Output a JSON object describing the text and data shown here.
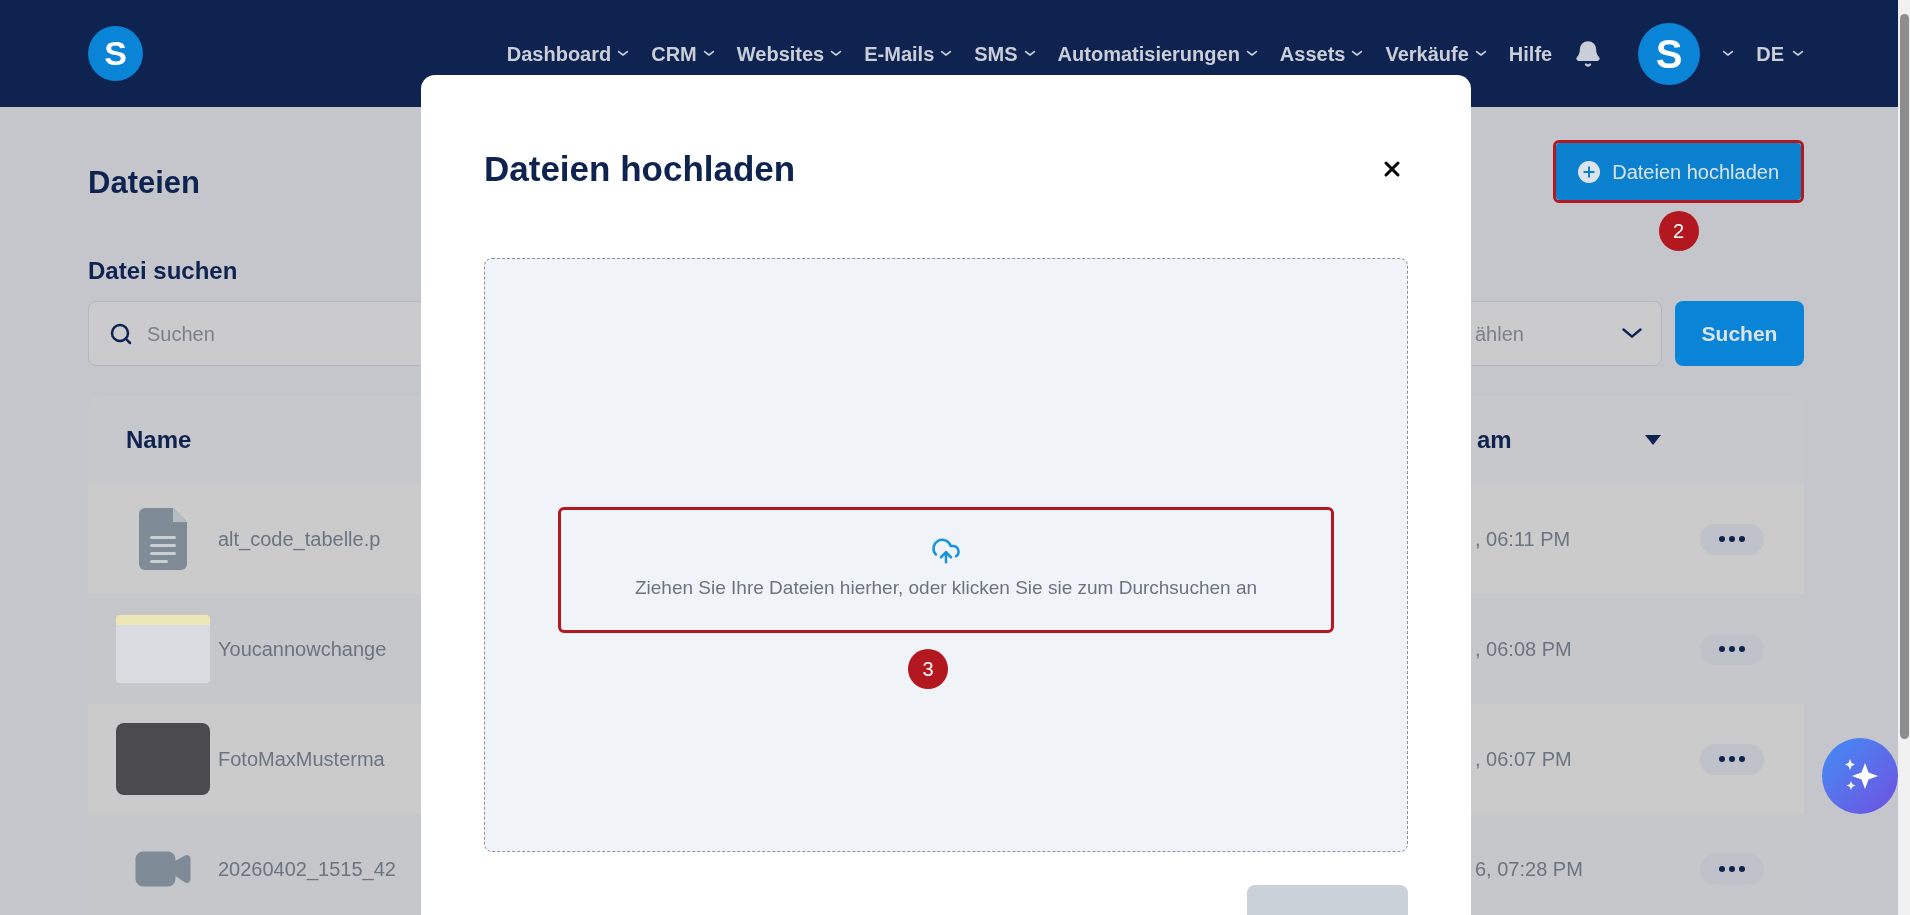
{
  "nav": {
    "logo": "S",
    "items": [
      {
        "label": "Dashboard",
        "dropdown": true
      },
      {
        "label": "CRM",
        "dropdown": true
      },
      {
        "label": "Websites",
        "dropdown": true
      },
      {
        "label": "E-Mails",
        "dropdown": true
      },
      {
        "label": "SMS",
        "dropdown": true
      },
      {
        "label": "Automatisierungen",
        "dropdown": true
      },
      {
        "label": "Assets",
        "dropdown": true
      },
      {
        "label": "Verkäufe",
        "dropdown": true
      },
      {
        "label": "Hilfe",
        "dropdown": false
      }
    ],
    "avatar": "S",
    "language": "DE"
  },
  "page": {
    "title": "Dateien",
    "upload_button": {
      "label": "Dateien hochladen",
      "highlighted": true,
      "badge": "2"
    },
    "search_label": "Datei suchen",
    "search": {
      "placeholder": "Suchen"
    },
    "select": {
      "placeholder": "ählen"
    },
    "search_button": "Suchen"
  },
  "table": {
    "columns": [
      {
        "label": "Name"
      },
      {
        "label": "am"
      }
    ],
    "rows": [
      {
        "kind": "document",
        "name": "alt_code_tabelle.p",
        "date": ", 06:11 PM"
      },
      {
        "kind": "screenshot",
        "name": "Youcannowchange",
        "date": ", 06:08 PM"
      },
      {
        "kind": "photo",
        "name": "FotoMaxMusterma",
        "date": ", 06:07 PM"
      },
      {
        "kind": "video",
        "name": "20260402_1515_42",
        "date": "6, 07:28 PM"
      }
    ]
  },
  "modal": {
    "title": "Dateien hochladen",
    "dropzone": {
      "text": "Ziehen Sie Ihre Dateien hierher, oder klicken Sie sie zum Durchsuchen an",
      "highlighted": true,
      "badge": "3"
    }
  }
}
